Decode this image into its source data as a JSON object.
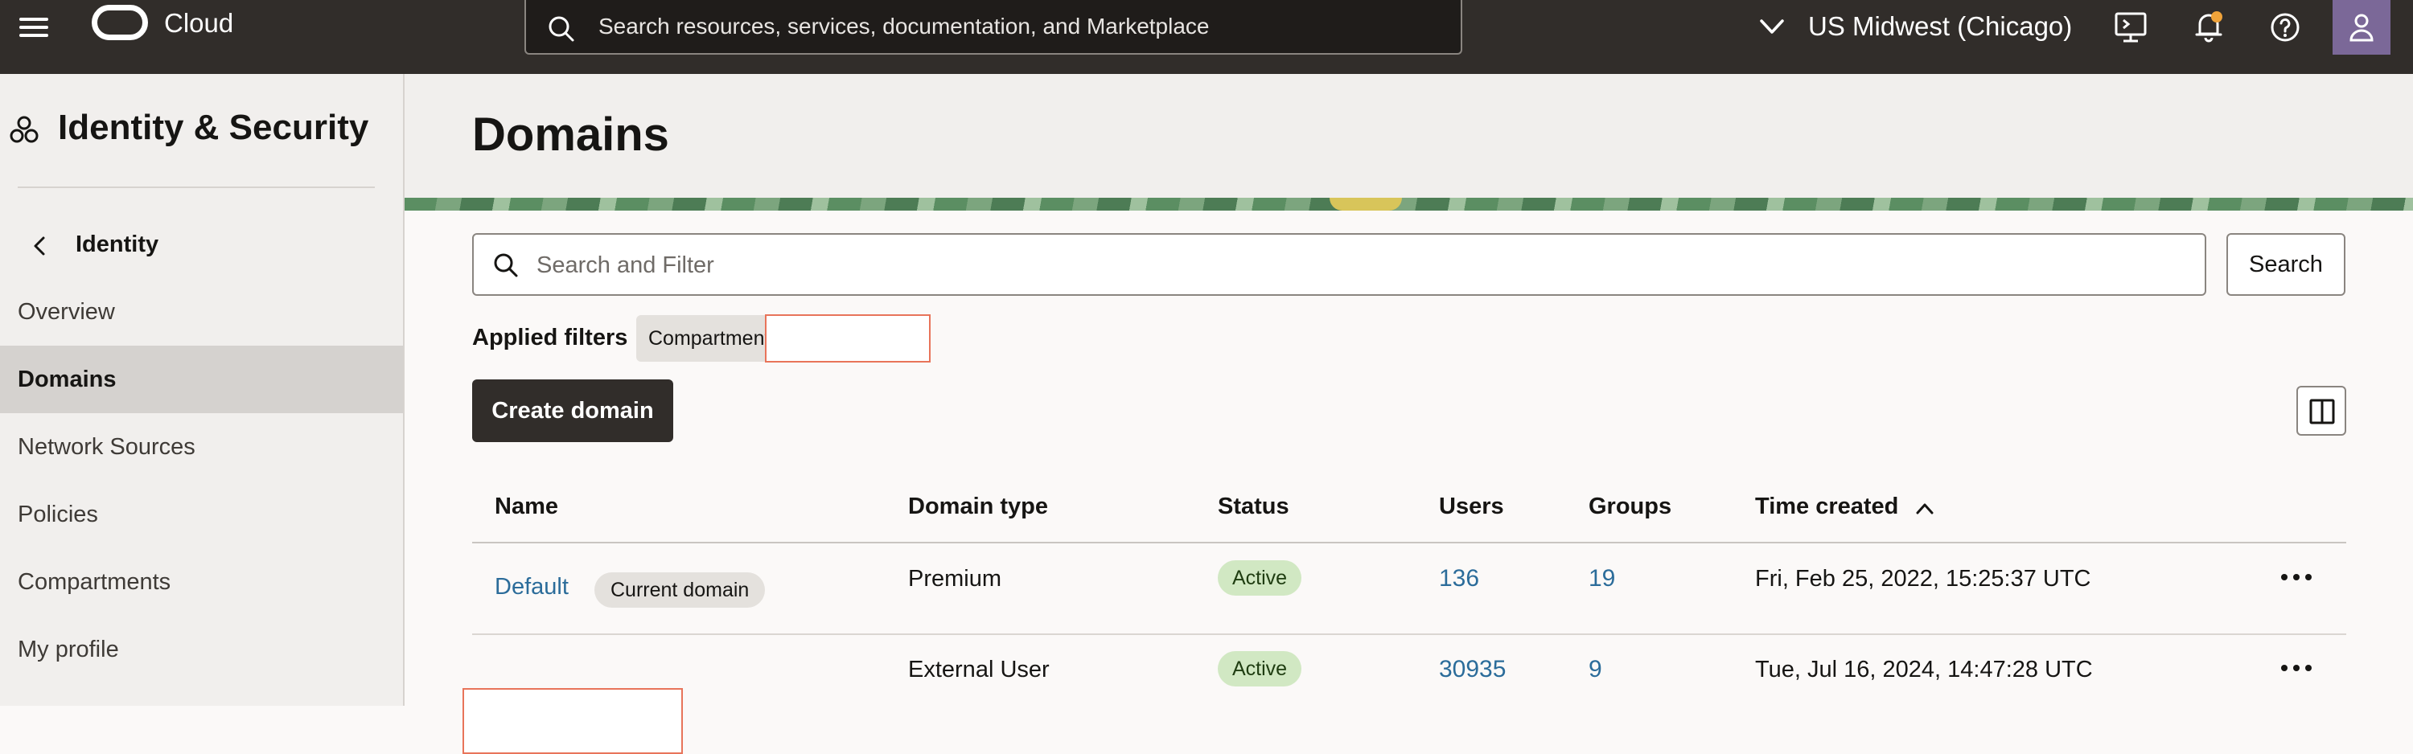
{
  "topbar": {
    "brand": "Cloud",
    "search_placeholder": "Search resources, services, documentation, and Marketplace",
    "region": "US Midwest (Chicago)"
  },
  "sidebar": {
    "title": "Identity & Security",
    "parent": "Identity",
    "items": [
      {
        "label": "Overview",
        "active": false
      },
      {
        "label": "Domains",
        "active": true
      },
      {
        "label": "Network Sources",
        "active": false
      },
      {
        "label": "Policies",
        "active": false
      },
      {
        "label": "Compartments",
        "active": false
      },
      {
        "label": "My profile",
        "active": false
      }
    ]
  },
  "main": {
    "title": "Domains",
    "filter_placeholder": "Search and Filter",
    "search_label": "Search",
    "applied_filters_label": "Applied filters",
    "filter_chip": "Compartment",
    "create_label": "Create domain"
  },
  "table": {
    "columns": [
      "Name",
      "Domain type",
      "Status",
      "Users",
      "Groups",
      "Time created"
    ],
    "rows": [
      {
        "name": "Default",
        "tag": "Current domain",
        "type": "Premium",
        "status": "Active",
        "users": "136",
        "groups": "19",
        "created": "Fri, Feb 25, 2022, 15:25:37 UTC"
      },
      {
        "name": "",
        "tag": "",
        "type": "External User",
        "status": "Active",
        "users": "30935",
        "groups": "9",
        "created": "Tue, Jul 16, 2024, 14:47:28 UTC"
      }
    ]
  },
  "colors": {
    "topbar": "#312d2a",
    "accent_link": "#2b6c9a",
    "status_active_bg": "#d1e8c3",
    "primary_button": "#312d2a"
  }
}
